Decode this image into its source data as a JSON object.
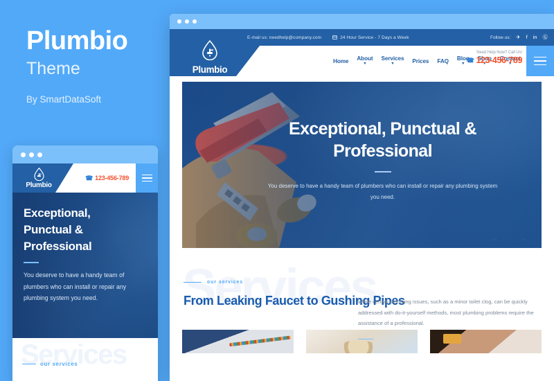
{
  "promo": {
    "title": "Plumbio",
    "subtitle": "Theme",
    "byline": "By SmartDataSoft"
  },
  "colors": {
    "page_background": "#52a9f8",
    "header_blue": "#2360a5",
    "accent_light_blue": "#7cc0fb",
    "phone_orange": "#f4512c",
    "heading_blue": "#1a5cae",
    "watermark": "#f1f5fb"
  },
  "desktop": {
    "topbar": {
      "email": "E-mail us: needhelp@company.com",
      "hours": "24 Hour Service - 7 Days a Week",
      "hours_icon": "calendar-icon",
      "follow_label": "Follow us:",
      "social": [
        {
          "name": "twitter-icon",
          "glyph": "✈"
        },
        {
          "name": "facebook-icon",
          "glyph": "f"
        },
        {
          "name": "linkedin-icon",
          "glyph": "in"
        },
        {
          "name": "google-plus-icon",
          "glyph": "Ⓖ"
        }
      ]
    },
    "logo": {
      "text": "Plumbio",
      "icon": "water-drop-faucet-icon"
    },
    "nav": [
      {
        "label": "Home",
        "has_dropdown": false
      },
      {
        "label": "About",
        "has_dropdown": true
      },
      {
        "label": "Services",
        "has_dropdown": true
      },
      {
        "label": "Prices",
        "has_dropdown": false
      },
      {
        "label": "FAQ",
        "has_dropdown": false
      },
      {
        "label": "Blog",
        "has_dropdown": true
      },
      {
        "label": "Shop",
        "has_dropdown": true
      },
      {
        "label": "Contact",
        "has_dropdown": true
      }
    ],
    "call": {
      "label": "Need Help Now? Call Us!",
      "number": "123-456-789",
      "icon": "phone-icon"
    },
    "menu_button": "hamburger-menu-icon",
    "hero": {
      "heading": "Exceptional, Punctual & Professional",
      "paragraph": "You deserve to have a handy team of plumbers who can install or repair any plumbing system you need.",
      "prev_arrow": "←",
      "next_arrow": "→"
    },
    "services": {
      "watermark": "Services",
      "tag": "our services",
      "heading": "From Leaking Faucet to Gushing Pipes",
      "paragraph": "While certain plumbing issues, such as a minor toilet clog, can be quickly addressed with do-it-yourself methods, most plumbing problems require the assistance of a professional."
    },
    "cards": [
      {
        "name": "service-card-electrical"
      },
      {
        "name": "service-card-pipe-fitting"
      },
      {
        "name": "service-card-repair"
      }
    ]
  },
  "mobile": {
    "logo": {
      "text": "Plumbio",
      "icon": "water-drop-faucet-icon"
    },
    "phone": "123-456-789",
    "phone_icon": "phone-icon",
    "menu_button": "hamburger-menu-icon",
    "hero": {
      "heading": "Exceptional, Punctual & Professional",
      "paragraph": "You deserve to have a handy team of plumbers who can install or repair any plumbing system you need."
    },
    "services": {
      "watermark": "Services",
      "tag": "our services"
    }
  }
}
